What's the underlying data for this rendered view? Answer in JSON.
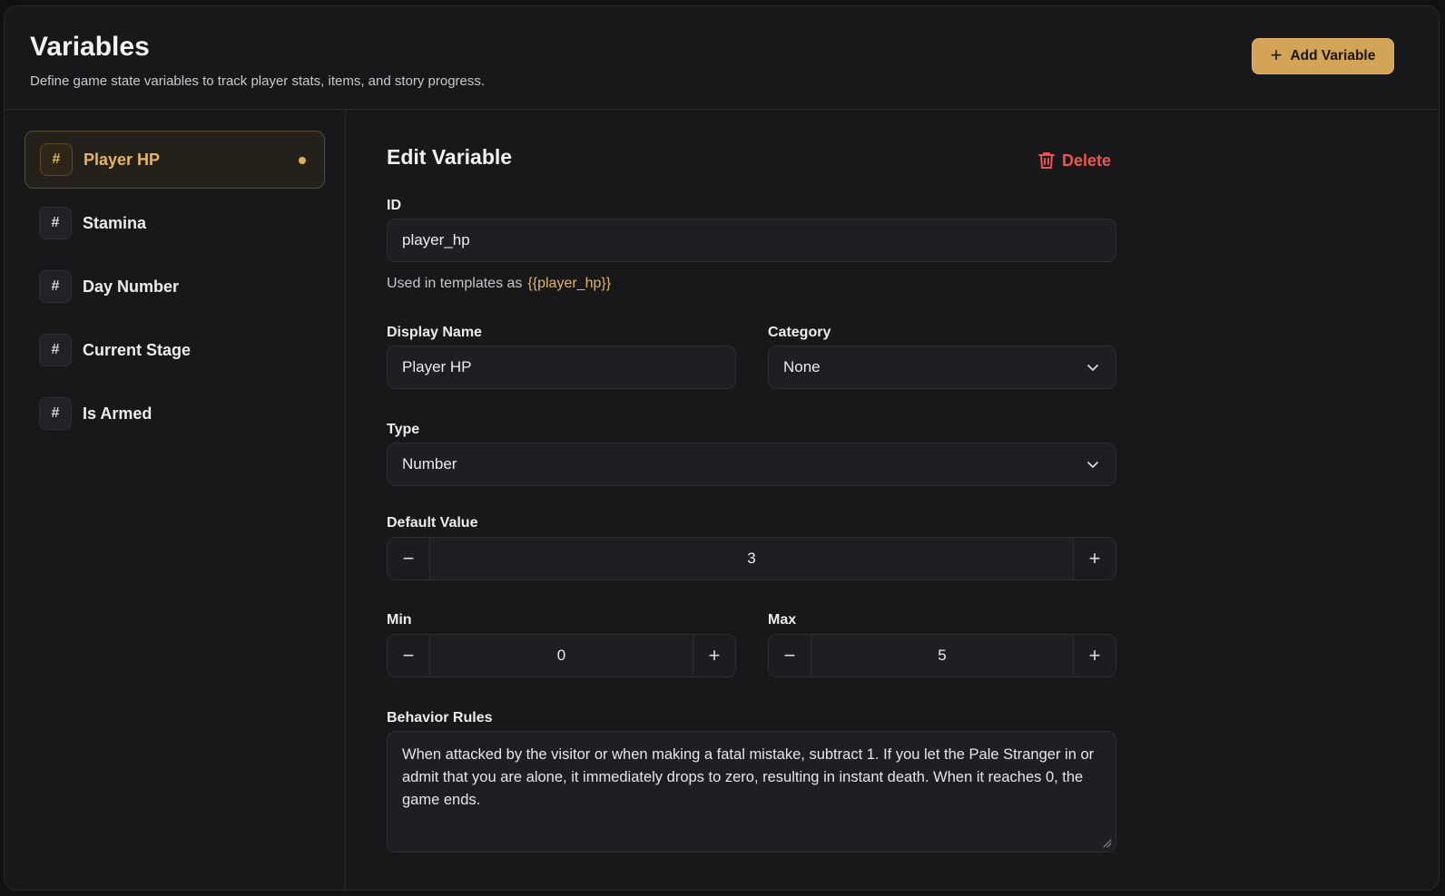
{
  "header": {
    "title": "Variables",
    "subtitle": "Define game state variables to track player stats, items, and story progress.",
    "add_button": "Add Variable"
  },
  "sidebar": {
    "items": [
      {
        "icon": "#",
        "label": "Player HP"
      },
      {
        "icon": "#",
        "label": "Stamina"
      },
      {
        "icon": "#",
        "label": "Day Number"
      },
      {
        "icon": "#",
        "label": "Current Stage"
      },
      {
        "icon": "#",
        "label": "Is Armed"
      }
    ],
    "active_index": 0
  },
  "editor": {
    "title": "Edit Variable",
    "delete_label": "Delete",
    "id_label": "ID",
    "id_value": "player_hp",
    "hint_prefix": "Used in templates as",
    "hint_template": "{{player_hp}}",
    "display_name_label": "Display Name",
    "display_name_value": "Player HP",
    "category_label": "Category",
    "category_value": "None",
    "type_label": "Type",
    "type_value": "Number",
    "default_label": "Default Value",
    "default_value": "3",
    "min_label": "Min",
    "min_value": "0",
    "max_label": "Max",
    "max_value": "5",
    "behavior_label": "Behavior Rules",
    "behavior_value": "When attacked by the visitor or when making a fatal mistake, subtract 1. If you let the Pale Stranger in or admit that you are alone, it immediately drops to zero, resulting in instant death. When it reaches 0, the game ends."
  },
  "icons": {
    "add": "plus-icon",
    "delete": "trash-icon",
    "dropdown": "chevron-down-icon",
    "decrement": "minus-icon",
    "increment": "plus-icon",
    "resize": "resize-grip-icon"
  },
  "colors": {
    "accent": "#d3a458",
    "accent_text": "#e4b567",
    "danger": "#ef5350",
    "background": "#18181b"
  },
  "stepper_symbols": {
    "minus": "−",
    "plus": "+"
  }
}
